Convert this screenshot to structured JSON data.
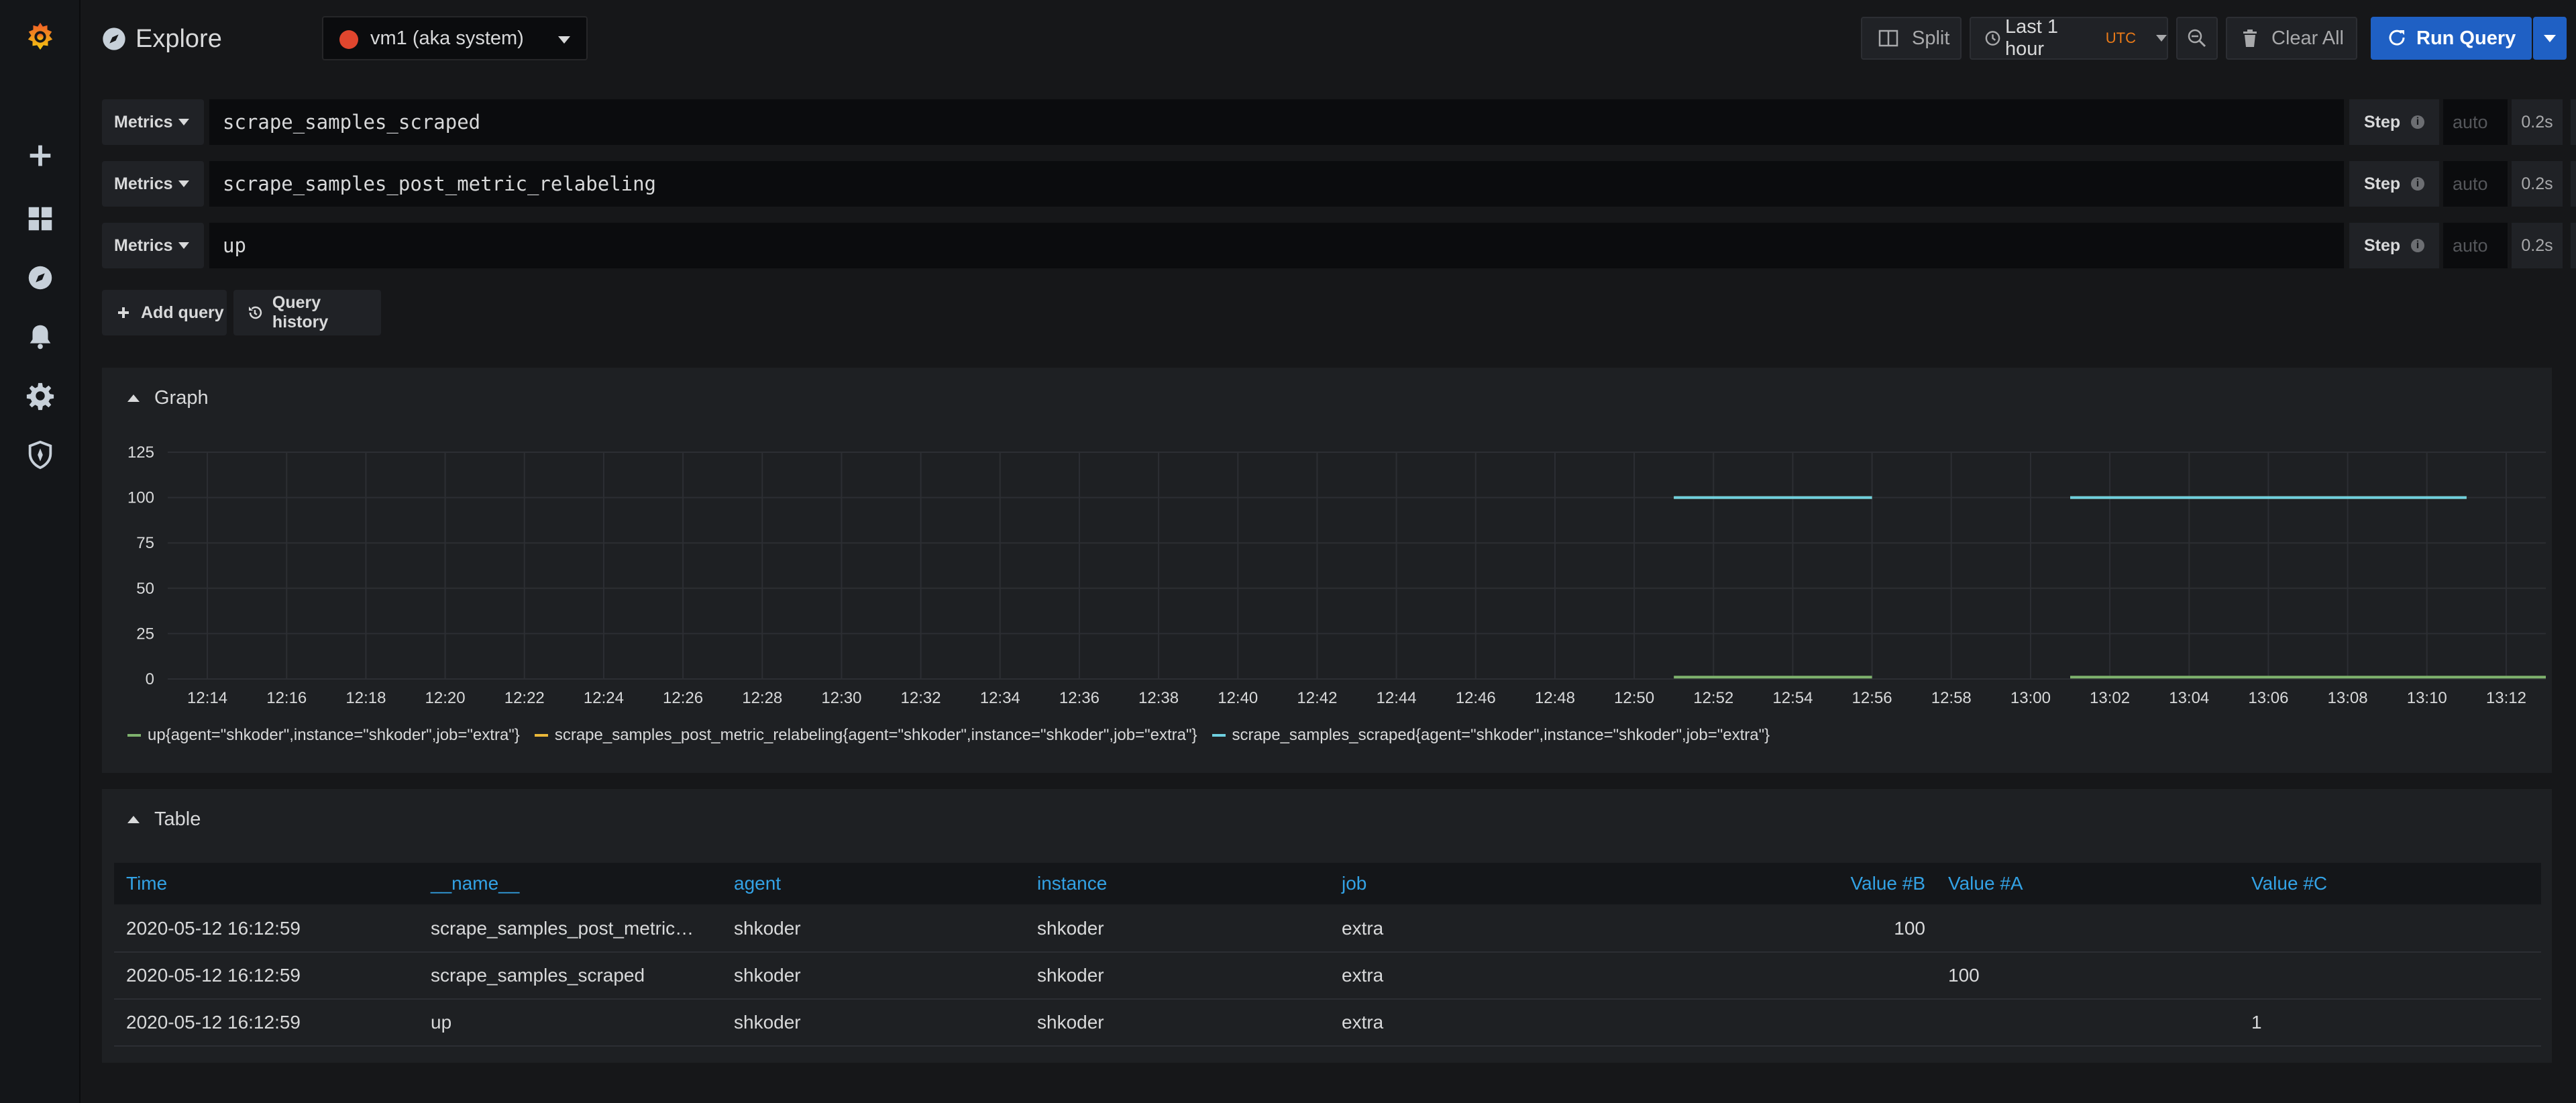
{
  "header": {
    "title": "Explore",
    "datasource": "vm1 (aka system)",
    "split_label": "Split",
    "time_range": "Last 1 hour",
    "timezone": "UTC",
    "clear_label": "Clear All",
    "run_label": "Run Query"
  },
  "sidebar": {
    "items": [
      "grafana-logo-icon",
      "plus-icon",
      "dashboards-icon",
      "explore-icon",
      "alert-bell-icon",
      "gear-icon",
      "shield-icon"
    ]
  },
  "queries": [
    {
      "type_label": "Metrics",
      "expr": "scrape_samples_scraped",
      "step_label": "Step",
      "step_placeholder": "auto",
      "duration": "0.2s"
    },
    {
      "type_label": "Metrics",
      "expr": "scrape_samples_post_metric_relabeling",
      "step_label": "Step",
      "step_placeholder": "auto",
      "duration": "0.2s"
    },
    {
      "type_label": "Metrics",
      "expr": "up",
      "step_label": "Step",
      "step_placeholder": "auto",
      "duration": "0.2s"
    }
  ],
  "actions": {
    "add_query": "Add query",
    "query_history": "Query history"
  },
  "graph_panel": {
    "title": "Graph"
  },
  "table_panel": {
    "title": "Table"
  },
  "chart_data": {
    "type": "line",
    "title": "",
    "xlabel": "",
    "ylabel": "",
    "x_ticks": [
      "12:14",
      "12:16",
      "12:18",
      "12:20",
      "12:22",
      "12:24",
      "12:26",
      "12:28",
      "12:30",
      "12:32",
      "12:34",
      "12:36",
      "12:38",
      "12:40",
      "12:42",
      "12:44",
      "12:46",
      "12:48",
      "12:50",
      "12:52",
      "12:54",
      "12:56",
      "12:58",
      "13:00",
      "13:02",
      "13:04",
      "13:06",
      "13:08",
      "13:10",
      "13:12"
    ],
    "y_ticks": [
      0,
      25,
      50,
      75,
      100,
      125
    ],
    "xlim": [
      "12:13",
      "13:13"
    ],
    "ylim": [
      0,
      125
    ],
    "grid": true,
    "legend_position": "bottom",
    "series": [
      {
        "name": "up{agent=\"shkoder\",instance=\"shkoder\",job=\"extra\"}",
        "color": "#7eb26d",
        "segments": [
          [
            [
              "12:51",
              1
            ],
            [
              "12:56",
              1
            ]
          ],
          [
            [
              "13:01",
              1
            ],
            [
              "13:13",
              1
            ]
          ]
        ]
      },
      {
        "name": "scrape_samples_post_metric_relabeling{agent=\"shkoder\",instance=\"shkoder\",job=\"extra\"}",
        "color": "#eab839",
        "segments": [
          [
            [
              "12:51",
              100
            ],
            [
              "12:56",
              100
            ]
          ],
          [
            [
              "13:01",
              100
            ],
            [
              "13:11",
              100
            ]
          ]
        ]
      },
      {
        "name": "scrape_samples_scraped{agent=\"shkoder\",instance=\"shkoder\",job=\"extra\"}",
        "color": "#6ed0e0",
        "segments": [
          [
            [
              "12:51",
              100
            ],
            [
              "12:56",
              100
            ]
          ],
          [
            [
              "13:01",
              100
            ],
            [
              "13:11",
              100
            ]
          ]
        ]
      }
    ]
  },
  "table": {
    "columns": [
      "Time",
      "__name__",
      "agent",
      "instance",
      "job",
      "Value #B",
      "Value #A",
      "Value #C"
    ],
    "rows": [
      [
        "2020-05-12 16:12:59",
        "scrape_samples_post_metric_relabeling",
        "shkoder",
        "shkoder",
        "extra",
        "100",
        "",
        ""
      ],
      [
        "2020-05-12 16:12:59",
        "scrape_samples_scraped",
        "shkoder",
        "shkoder",
        "extra",
        "",
        "100",
        ""
      ],
      [
        "2020-05-12 16:12:59",
        "up",
        "shkoder",
        "shkoder",
        "extra",
        "",
        "",
        "1"
      ]
    ]
  }
}
